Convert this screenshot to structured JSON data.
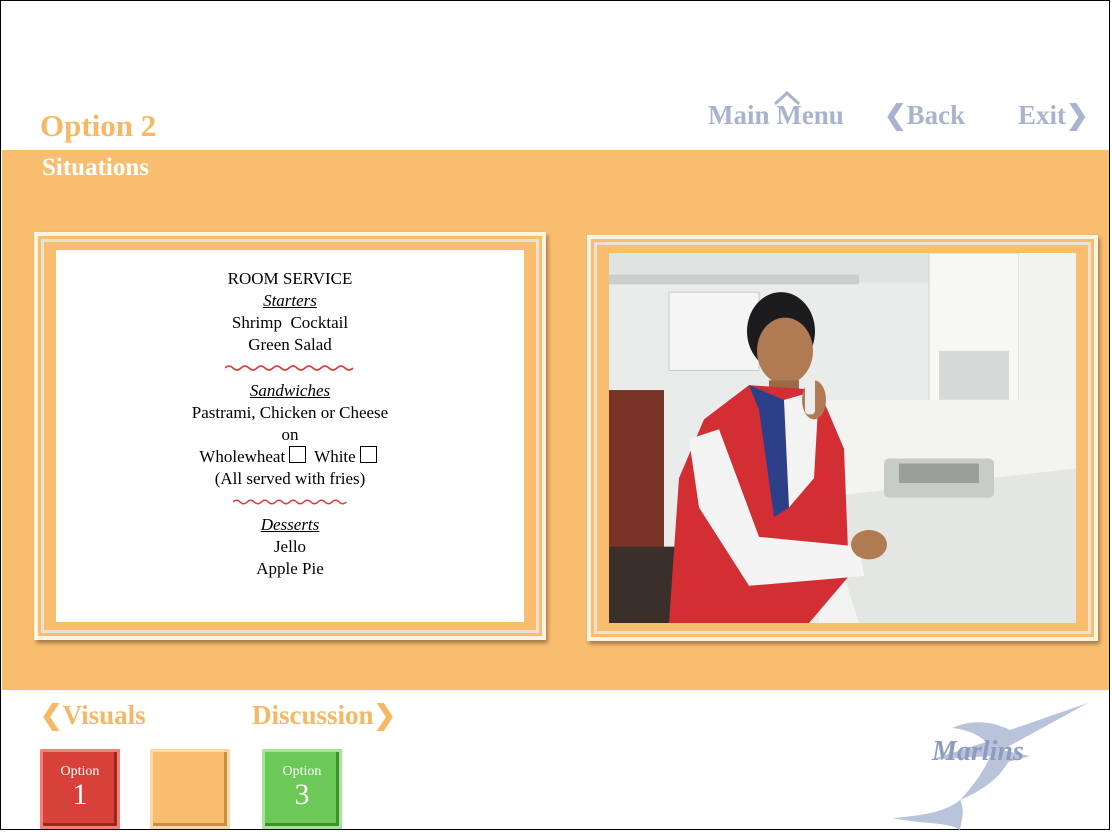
{
  "header": {
    "title": "Option 2",
    "subtitle": "Situations",
    "nav": {
      "main_menu": "Main Menu",
      "back": "Back",
      "exit": "Exit"
    }
  },
  "menu": {
    "heading": "ROOM SERVICE",
    "starters_heading": "Starters",
    "starters": [
      "Shrimp  Cocktail",
      "Green Salad"
    ],
    "sandwiches_heading": "Sandwiches",
    "sandwich_line": "Pastrami, Chicken or Cheese",
    "on": "on",
    "bread_wholewheat": "Wholewheat",
    "bread_white": "White",
    "served_note": "(All served with fries)",
    "desserts_heading": "Desserts",
    "desserts": [
      "Jello",
      "Apple Pie"
    ]
  },
  "footer": {
    "visuals": "Visuals",
    "discussion": "Discussion",
    "option_word": "Option",
    "option1_num": "1",
    "option3_num": "3",
    "logo_text": "Marlins"
  },
  "colors": {
    "accent_orange": "#f9bd6f",
    "title_orange": "#f7b865",
    "nav_blue": "#a8b4cf",
    "option1_red": "#d8403a",
    "option3_green": "#6cc957"
  }
}
